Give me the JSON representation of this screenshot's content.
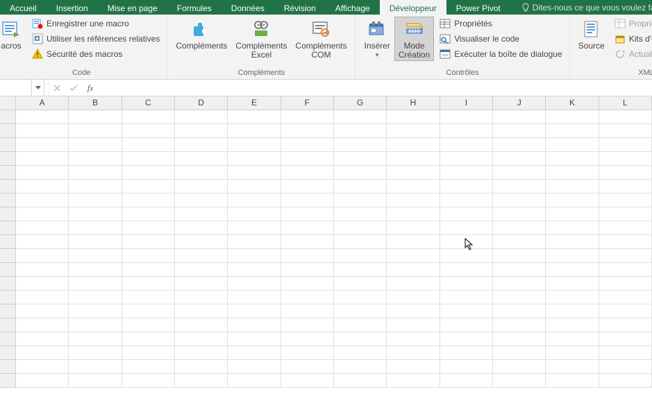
{
  "tabs": {
    "accueil": "Accueil",
    "insertion": "Insertion",
    "mise_en_page": "Mise en page",
    "formules": "Formules",
    "donnees": "Données",
    "revision": "Révision",
    "affichage": "Affichage",
    "developpeur": "Développeur",
    "power_pivot": "Power Pivot"
  },
  "tellme": "Dites-nous ce que vous voulez fa",
  "code_group": {
    "label": "Code",
    "macros": "acros",
    "record": "Enregistrer une macro",
    "relative": "Utiliser les références relatives",
    "security": "Sécurité des macros"
  },
  "addins_group": {
    "label": "Compléments",
    "addins": "Compléments",
    "excel_addins": "Compléments\nExcel",
    "com_addins": "Compléments\nCOM"
  },
  "controls_group": {
    "label": "Contrôles",
    "insert": "Insérer",
    "design": "Mode\nCréation",
    "properties": "Propriétés",
    "view_code": "Visualiser le code",
    "run_dialog": "Exécuter la boîte de dialogue"
  },
  "xml_group": {
    "label": "XML",
    "source": "Source",
    "map_props": "Propriétés du mappage",
    "expansion": "Kits d'extension",
    "refresh": "Actualiser les données"
  },
  "namebox": "",
  "formula": "",
  "columns": [
    "A",
    "B",
    "C",
    "D",
    "E",
    "F",
    "G",
    "H",
    "I",
    "J",
    "K",
    "L"
  ],
  "row_count": 20
}
